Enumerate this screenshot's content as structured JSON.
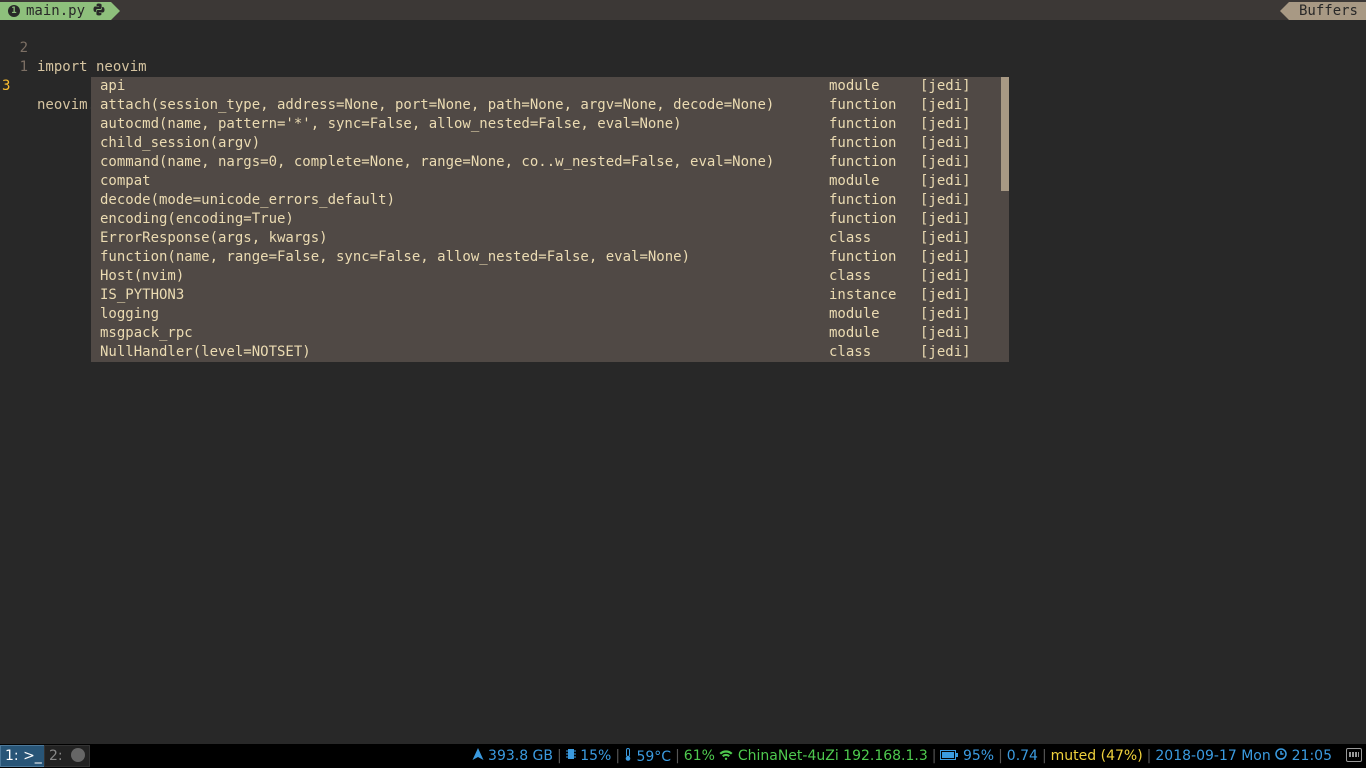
{
  "tabline": {
    "active_tab_number": "1",
    "active_tab_name": "main.py",
    "active_tab_icon": "python-icon",
    "buffers_label": "Buffers"
  },
  "editor": {
    "lines": [
      {
        "number": "2",
        "text": "import neovim",
        "current": false
      },
      {
        "number": "1",
        "text": "",
        "current": false
      },
      {
        "number": "3",
        "text": "neovim.",
        "current": true
      }
    ]
  },
  "completion_popup": {
    "items": [
      {
        "word": "api",
        "kind": "module",
        "menu": "[jedi]"
      },
      {
        "word": "attach(session_type, address=None, port=None, path=None, argv=None, decode=None)",
        "kind": "function",
        "menu": "[jedi]"
      },
      {
        "word": "autocmd(name, pattern='*', sync=False, allow_nested=False, eval=None)",
        "kind": "function",
        "menu": "[jedi]"
      },
      {
        "word": "child_session(argv)",
        "kind": "function",
        "menu": "[jedi]"
      },
      {
        "word": "command(name, nargs=0, complete=None, range=None, co..w_nested=False, eval=None)",
        "kind": "function",
        "menu": "[jedi]"
      },
      {
        "word": "compat",
        "kind": "module",
        "menu": "[jedi]"
      },
      {
        "word": "decode(mode=unicode_errors_default)",
        "kind": "function",
        "menu": "[jedi]"
      },
      {
        "word": "encoding(encoding=True)",
        "kind": "function",
        "menu": "[jedi]"
      },
      {
        "word": "ErrorResponse(args, kwargs)",
        "kind": "class",
        "menu": "[jedi]"
      },
      {
        "word": "function(name, range=False, sync=False, allow_nested=False, eval=None)",
        "kind": "function",
        "menu": "[jedi]"
      },
      {
        "word": "Host(nvim)",
        "kind": "class",
        "menu": "[jedi]"
      },
      {
        "word": "IS_PYTHON3",
        "kind": "instance",
        "menu": "[jedi]"
      },
      {
        "word": "logging",
        "kind": "module",
        "menu": "[jedi]"
      },
      {
        "word": "msgpack_rpc",
        "kind": "module",
        "menu": "[jedi]"
      },
      {
        "word": "NullHandler(level=NOTSET)",
        "kind": "class",
        "menu": "[jedi]"
      }
    ]
  },
  "statusbar": {
    "workspaces": [
      {
        "label": "1: >_",
        "active": true
      },
      {
        "label": "2:",
        "active": false
      }
    ],
    "disk": "393.8 GB",
    "cpu": "15%",
    "temp": "59°C",
    "wifi_quality": "61%",
    "wifi_ssid": "ChinaNet-4uZi 192.168.1.3",
    "battery": "95%",
    "load": "0.74",
    "volume": "muted (47%)",
    "date": "2018-09-17 Mon",
    "time": "21:05",
    "colors": {
      "blue": "#3b9be0",
      "green": "#4ec94e",
      "yellow": "#f0d23c"
    }
  }
}
